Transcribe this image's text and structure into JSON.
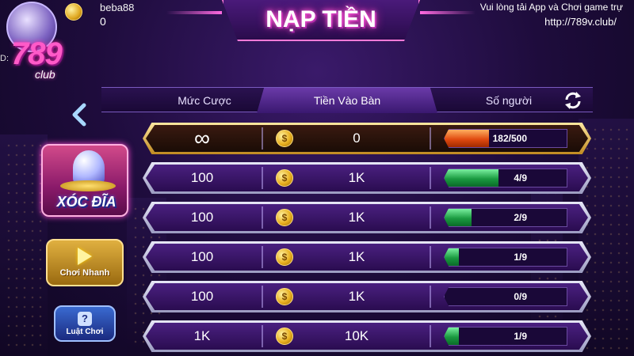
{
  "header": {
    "username": "beba88",
    "balance": "0",
    "id_prefix": "D:",
    "logo_number": "789",
    "logo_subtitle": "club",
    "title": "NẠP TIỀN",
    "notice_text": "Vui lòng tải App và Chơi game trự",
    "notice_url": "http://789v.club/"
  },
  "columns": {
    "bet": "Mức Cược",
    "entry": "Tiền Vào Bàn",
    "players": "Số người"
  },
  "sidebar": {
    "game_title": "XÓC ĐĨA",
    "quick_play_label": "Chơi Nhanh",
    "rules_label": "Luật Chơi",
    "rules_icon_glyph": "?"
  },
  "rows": [
    {
      "bet": "∞",
      "entry": "0",
      "players": "182/500",
      "fill": 0.364,
      "color": "red",
      "style": "gold"
    },
    {
      "bet": "100",
      "entry": "1K",
      "players": "4/9",
      "fill": 0.444,
      "color": "green",
      "style": "silver"
    },
    {
      "bet": "100",
      "entry": "1K",
      "players": "2/9",
      "fill": 0.222,
      "color": "green",
      "style": "silver"
    },
    {
      "bet": "100",
      "entry": "1K",
      "players": "1/9",
      "fill": 0.111,
      "color": "green",
      "style": "silver"
    },
    {
      "bet": "100",
      "entry": "1K",
      "players": "0/9",
      "fill": 0.0,
      "color": "green",
      "style": "silver"
    },
    {
      "bet": "1K",
      "entry": "10K",
      "players": "1/9",
      "fill": 0.111,
      "color": "green",
      "style": "silver"
    }
  ],
  "colors": {
    "accent_pink": "#ff5ac8",
    "progress_green": "#1a9a40",
    "progress_red": "#e04a10",
    "gold": "#e8b020"
  },
  "icons": {
    "coin": "coin-icon",
    "refresh": "refresh-icon",
    "back": "back-arrow-icon",
    "play": "play-icon",
    "rules": "question-icon"
  }
}
